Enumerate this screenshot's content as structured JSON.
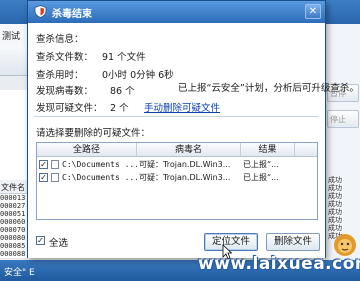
{
  "background": {
    "tab_label": "测试",
    "column_header": "文件名",
    "rows": [
      "000013",
      "000027",
      "000051",
      "000060",
      "000070",
      "000080",
      "000085",
      "000088"
    ],
    "right_buttons": [
      "暂停",
      "停止"
    ],
    "right_rows": [
      "成功",
      "成功",
      "成功",
      "成功",
      "成功",
      "成功",
      "成功",
      "成功"
    ],
    "status_text": "安全\" E"
  },
  "dialog": {
    "title": "杀毒结束",
    "info_title": "查杀信息：",
    "stats": [
      {
        "label": "查杀文件数：",
        "value": "91 个文件"
      },
      {
        "label": "查杀用时：",
        "value": "0小时 0分钟 6秒"
      },
      {
        "label": "发现病毒数：",
        "value": "86 个"
      },
      {
        "label": "发现可疑文件：",
        "value": "2 个"
      }
    ],
    "cloud_note": "已上报“云安全”计划，分析后可升级查杀。",
    "manual_delete_link": "手动删除可疑文件",
    "prompt": "请选择要删除的可疑文件：",
    "columns": [
      "全路径",
      "病毒名",
      "结果"
    ],
    "rows": [
      {
        "checked": true,
        "path": "C:\\Documents ...",
        "virus": "可疑：Trojan.DL.Win3...",
        "result": "已上报“..."
      },
      {
        "checked": true,
        "path": "C:\\Documents ...",
        "virus": "可疑：Trojan.DL.Win3...",
        "result": "已上报“..."
      }
    ],
    "select_all_label": "全选",
    "select_all_checked": true,
    "locate_button": "定位文件",
    "delete_button": "删除文件"
  },
  "watermark": "www.laixuea.com",
  "colors": {
    "title_bar": "#3d7fc9",
    "link": "#0a3fb0",
    "border": "#1d4f8c"
  }
}
